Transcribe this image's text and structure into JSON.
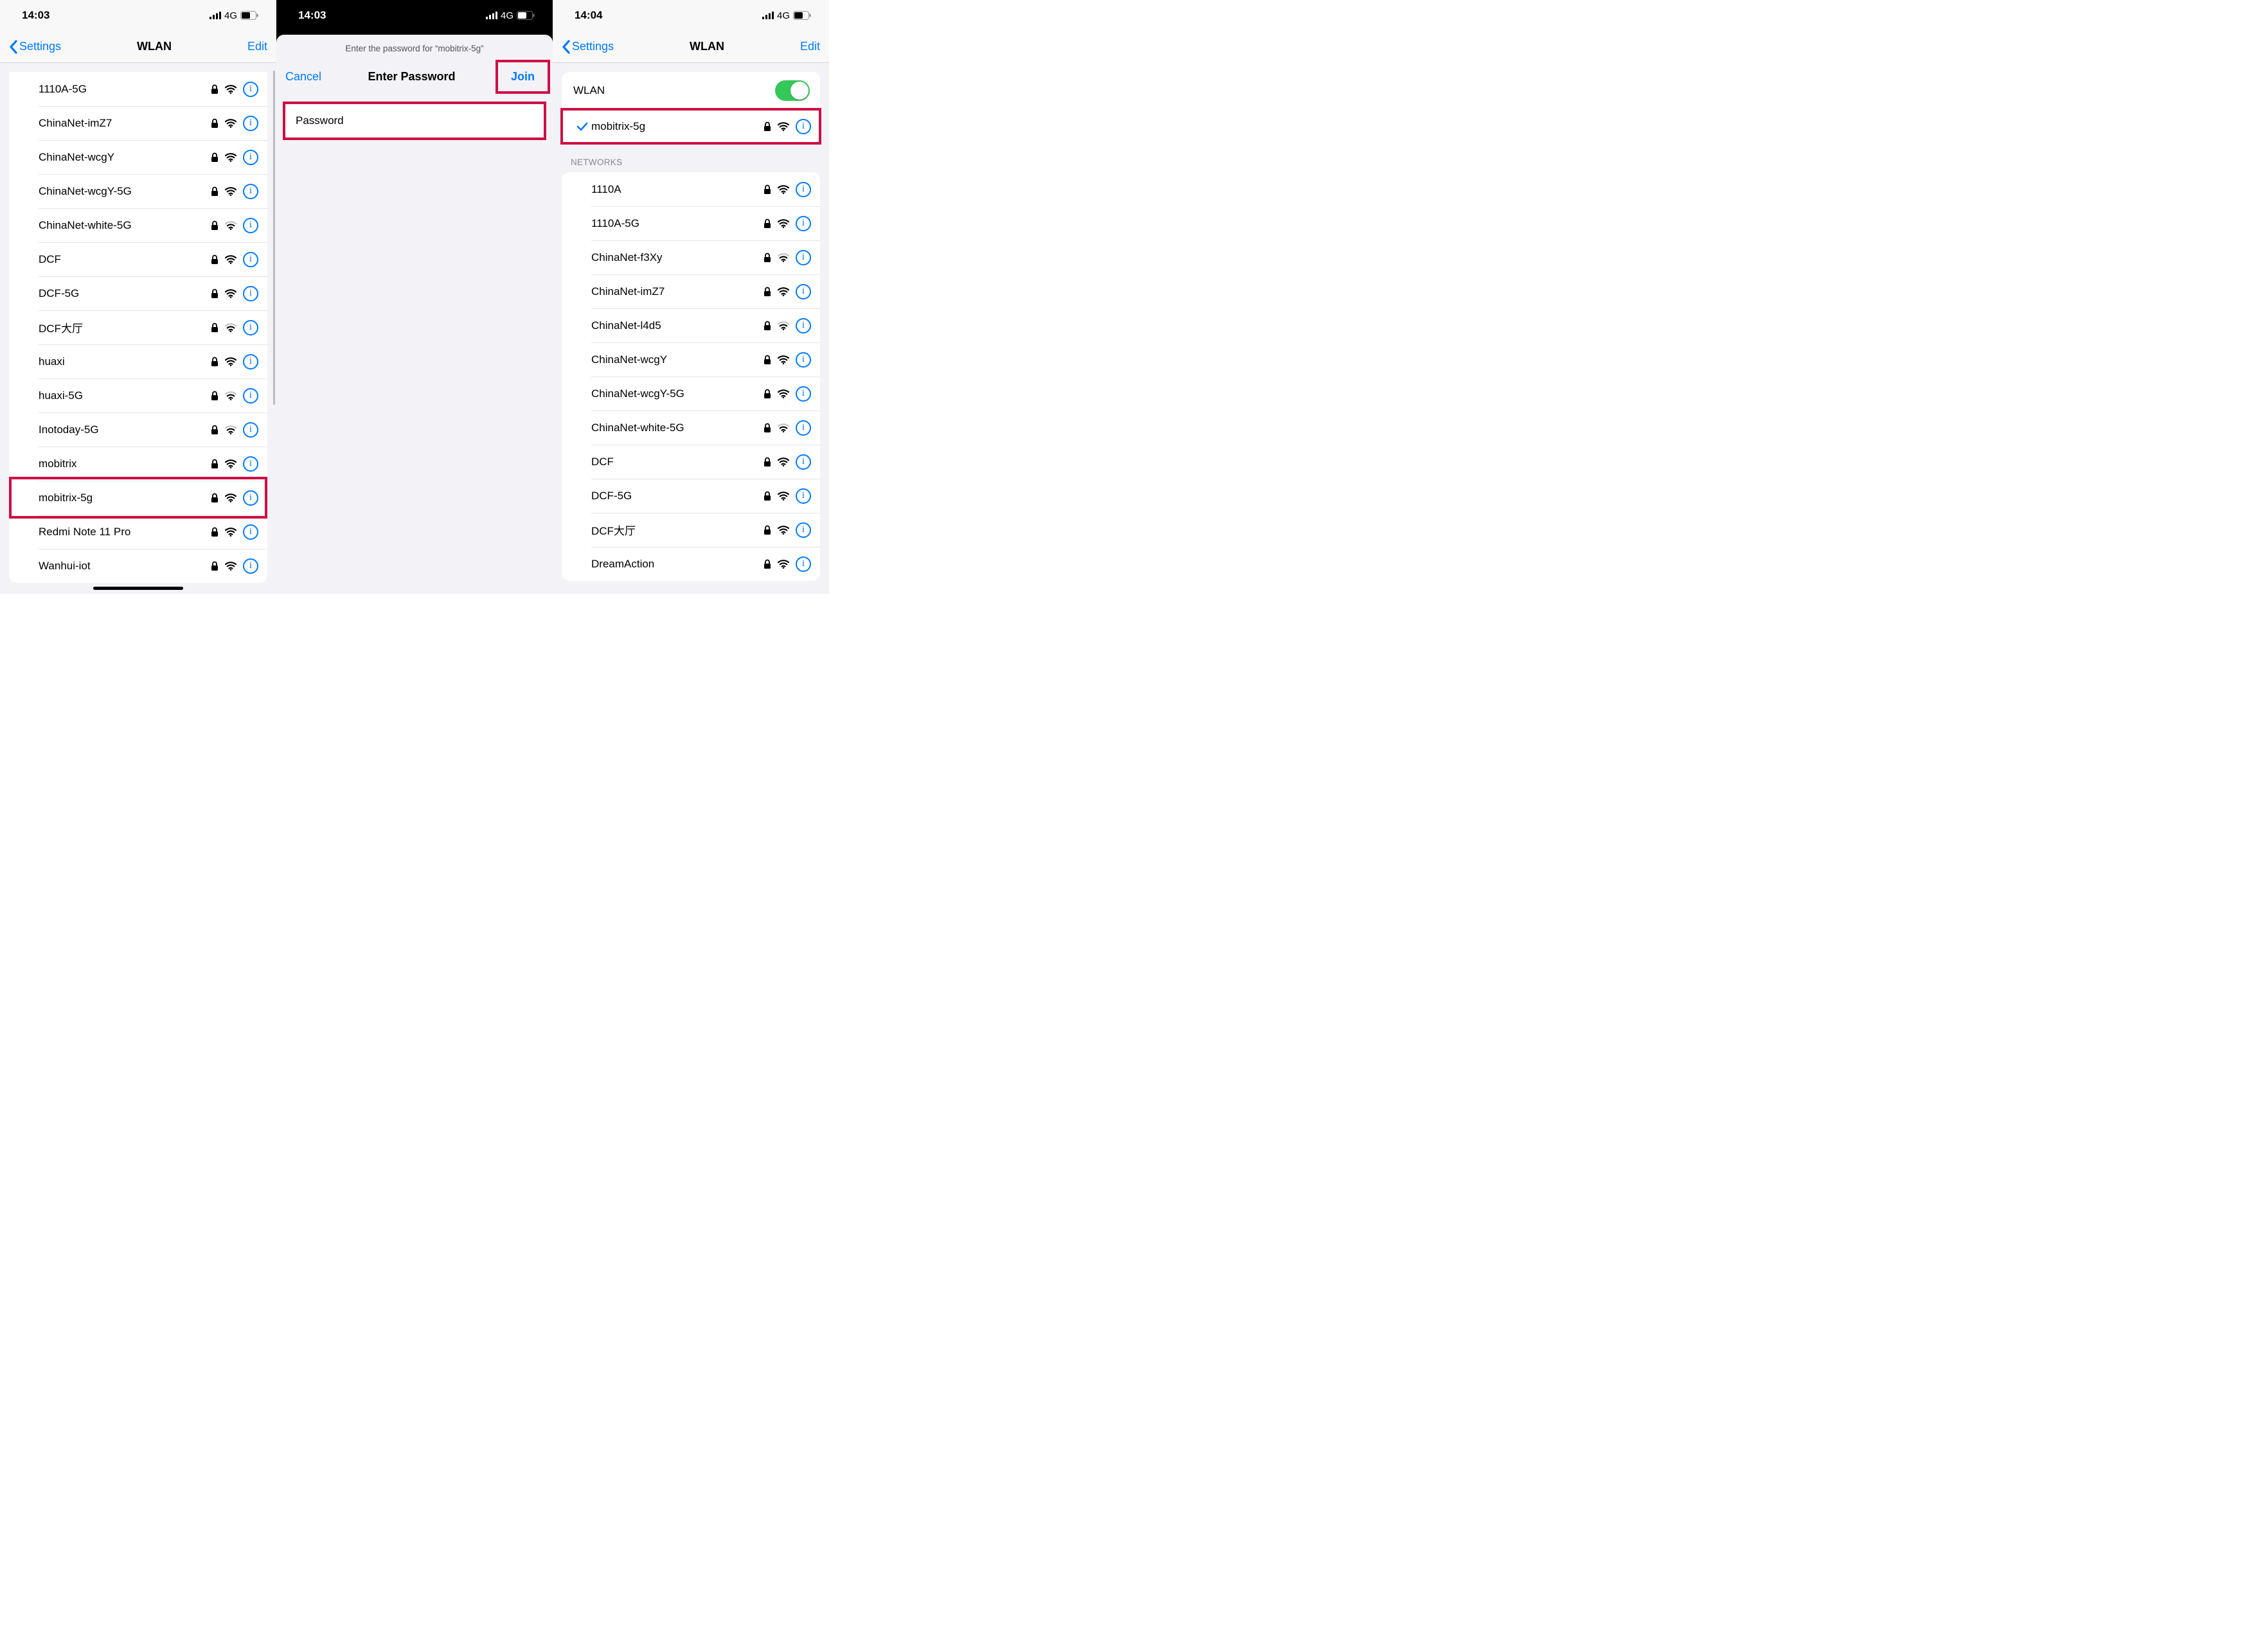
{
  "shared": {
    "network_indicator": "4G",
    "info_glyph": "i"
  },
  "screen1": {
    "status_time": "14:03",
    "nav_back": "Settings",
    "nav_title": "WLAN",
    "nav_edit": "Edit",
    "highlight_network": "mobitrix-5g",
    "networks": [
      {
        "name": "1110A-5G",
        "locked": true,
        "strength": "strong"
      },
      {
        "name": "ChinaNet-imZ7",
        "locked": true,
        "strength": "strong"
      },
      {
        "name": "ChinaNet-wcgY",
        "locked": true,
        "strength": "strong"
      },
      {
        "name": "ChinaNet-wcgY-5G",
        "locked": true,
        "strength": "strong"
      },
      {
        "name": "ChinaNet-white-5G",
        "locked": true,
        "strength": "weak"
      },
      {
        "name": "DCF",
        "locked": true,
        "strength": "strong"
      },
      {
        "name": "DCF-5G",
        "locked": true,
        "strength": "strong"
      },
      {
        "name": "DCF大厅",
        "locked": true,
        "strength": "weak"
      },
      {
        "name": "huaxi",
        "locked": true,
        "strength": "strong"
      },
      {
        "name": "huaxi-5G",
        "locked": true,
        "strength": "weak"
      },
      {
        "name": "Inotoday-5G",
        "locked": true,
        "strength": "weak"
      },
      {
        "name": "mobitrix",
        "locked": true,
        "strength": "strong"
      },
      {
        "name": "mobitrix-5g",
        "locked": true,
        "strength": "strong"
      },
      {
        "name": "Redmi Note 11 Pro",
        "locked": true,
        "strength": "strong"
      },
      {
        "name": "Wanhui-iot",
        "locked": true,
        "strength": "strong"
      }
    ]
  },
  "screen2": {
    "status_time": "14:03",
    "subtitle": "Enter the password for “mobitrix-5g”",
    "cancel": "Cancel",
    "title": "Enter Password",
    "join": "Join",
    "password_label": "Password"
  },
  "screen3": {
    "status_time": "14:04",
    "nav_back": "Settings",
    "nav_title": "WLAN",
    "nav_edit": "Edit",
    "wlan_label": "WLAN",
    "wlan_on": true,
    "connected": {
      "name": "mobitrix-5g",
      "locked": true,
      "strength": "strong"
    },
    "section_header": "Networks",
    "networks": [
      {
        "name": "1110A",
        "locked": true,
        "strength": "strong"
      },
      {
        "name": "1110A-5G",
        "locked": true,
        "strength": "strong"
      },
      {
        "name": "ChinaNet-f3Xy",
        "locked": true,
        "strength": "weak"
      },
      {
        "name": "ChinaNet-imZ7",
        "locked": true,
        "strength": "strong"
      },
      {
        "name": "ChinaNet-l4d5",
        "locked": true,
        "strength": "weak"
      },
      {
        "name": "ChinaNet-wcgY",
        "locked": true,
        "strength": "strong"
      },
      {
        "name": "ChinaNet-wcgY-5G",
        "locked": true,
        "strength": "strong"
      },
      {
        "name": "ChinaNet-white-5G",
        "locked": true,
        "strength": "weak"
      },
      {
        "name": "DCF",
        "locked": true,
        "strength": "strong"
      },
      {
        "name": "DCF-5G",
        "locked": true,
        "strength": "strong"
      },
      {
        "name": "DCF大厅",
        "locked": true,
        "strength": "strong"
      },
      {
        "name": "DreamAction",
        "locked": true,
        "strength": "strong"
      }
    ]
  }
}
